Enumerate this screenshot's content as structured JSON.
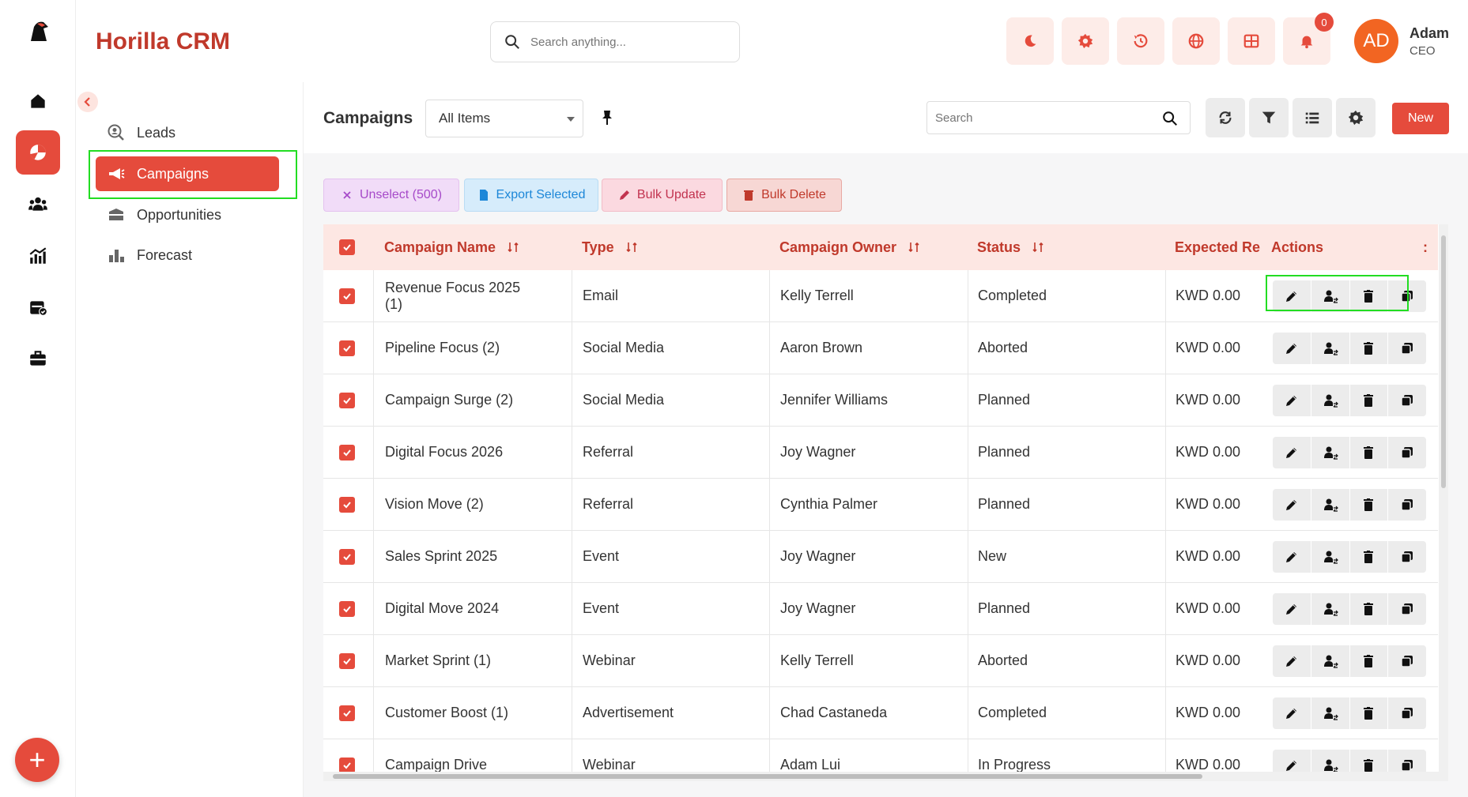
{
  "app": {
    "brand": "Horilla CRM",
    "search_placeholder": "Search anything...",
    "notification_count": "0",
    "user": {
      "initials": "AD",
      "name": "Adam",
      "role": "CEO"
    }
  },
  "rail": {
    "items": [
      {
        "icon": "home-icon"
      },
      {
        "icon": "pie-chart-icon",
        "active": true
      },
      {
        "icon": "users-icon"
      },
      {
        "icon": "analytics-icon"
      },
      {
        "icon": "calendar-check-icon"
      },
      {
        "icon": "briefcase-icon"
      }
    ],
    "fab": "+"
  },
  "subnav": {
    "items": [
      {
        "label": "Leads",
        "icon": "search-user-icon"
      },
      {
        "label": "Campaigns",
        "icon": "megaphone-icon",
        "active": true
      },
      {
        "label": "Opportunities",
        "icon": "box-icon"
      },
      {
        "label": "Forecast",
        "icon": "bar-chart-icon"
      }
    ]
  },
  "toolbar": {
    "title": "Campaigns",
    "view": "All Items",
    "search_placeholder": "Search",
    "new_label": "New"
  },
  "bulk": {
    "unselect": "Unselect (500)",
    "export": "Export Selected",
    "update": "Bulk Update",
    "delete": "Bulk Delete"
  },
  "table": {
    "headers": {
      "name": "Campaign Name",
      "type": "Type",
      "owner": "Campaign Owner",
      "status": "Status",
      "expected": "Expected Re",
      "actions": "Actions",
      "extra": ":"
    },
    "rows": [
      {
        "name": "Revenue Focus 2025 (1)",
        "type": "Email",
        "owner": "Kelly Terrell",
        "status": "Completed",
        "expected": "KWD 0.00"
      },
      {
        "name": "Pipeline Focus (2)",
        "type": "Social Media",
        "owner": "Aaron Brown",
        "status": "Aborted",
        "expected": "KWD 0.00"
      },
      {
        "name": "Campaign Surge (2)",
        "type": "Social Media",
        "owner": "Jennifer Williams",
        "status": "Planned",
        "expected": "KWD 0.00"
      },
      {
        "name": "Digital Focus 2026",
        "type": "Referral",
        "owner": "Joy Wagner",
        "status": "Planned",
        "expected": "KWD 0.00"
      },
      {
        "name": "Vision Move (2)",
        "type": "Referral",
        "owner": "Cynthia Palmer",
        "status": "Planned",
        "expected": "KWD 0.00"
      },
      {
        "name": "Sales Sprint 2025",
        "type": "Event",
        "owner": "Joy Wagner",
        "status": "New",
        "expected": "KWD 0.00"
      },
      {
        "name": "Digital Move 2024",
        "type": "Event",
        "owner": "Joy Wagner",
        "status": "Planned",
        "expected": "KWD 0.00"
      },
      {
        "name": "Market Sprint (1)",
        "type": "Webinar",
        "owner": "Kelly Terrell",
        "status": "Aborted",
        "expected": "KWD 0.00"
      },
      {
        "name": "Customer Boost (1)",
        "type": "Advertisement",
        "owner": "Chad Castaneda",
        "status": "Completed",
        "expected": "KWD 0.00"
      },
      {
        "name": "Campaign Drive",
        "type": "Webinar",
        "owner": "Adam Lui",
        "status": "In Progress",
        "expected": "KWD 0.00"
      }
    ]
  },
  "colors": {
    "accent": "#e54b3c",
    "brand": "#c0392b",
    "highlight": "#22dd22"
  }
}
